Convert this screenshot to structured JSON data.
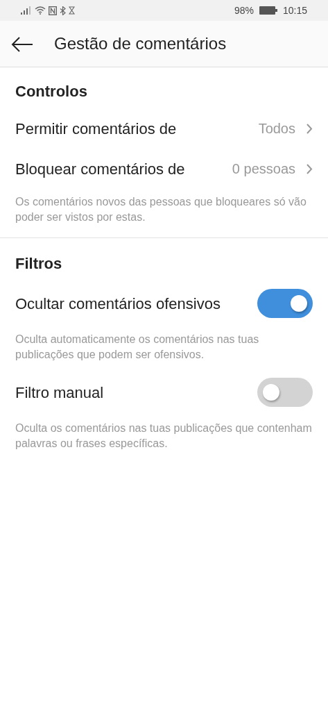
{
  "status_bar": {
    "battery": "98%",
    "time": "10:15"
  },
  "header": {
    "title": "Gestão de comentários"
  },
  "sections": [
    {
      "title": "Controlos",
      "items": [
        {
          "kind": "link",
          "label": "Permitir comentários de",
          "value": "Todos"
        },
        {
          "kind": "link",
          "label": "Bloquear comentários de",
          "value": "0 pessoas"
        }
      ],
      "note": "Os comentários novos das pessoas que bloqueares só vão poder ser vistos por estas."
    },
    {
      "title": "Filtros",
      "items": [
        {
          "kind": "toggle",
          "label": "Ocultar comentários ofensivos",
          "on": true,
          "description": "Oculta automaticamente os comentários nas tuas publicações que podem ser ofensivos."
        },
        {
          "kind": "toggle",
          "label": "Filtro manual",
          "on": false,
          "description": "Oculta os comentários nas tuas publicações que contenham palavras ou frases específicas."
        }
      ]
    }
  ]
}
